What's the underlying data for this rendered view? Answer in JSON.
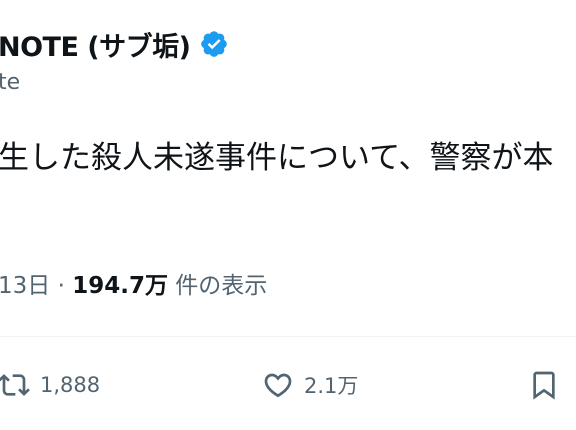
{
  "tweet": {
    "author_name": "NOTE (サブ垢)",
    "handle": "te",
    "text": "生した殺人未遂事件について、警察が本",
    "date": "13日",
    "separator": "·",
    "views_count": "194.7万",
    "views_label": "件の表示"
  },
  "actions": {
    "retweet_count": "1,888",
    "like_count": "2.1万"
  },
  "colors": {
    "verified_badge": "#1d9bf0",
    "secondary_text": "#536471",
    "primary_text": "#0f1419"
  },
  "icons": [
    "verified-badge-icon",
    "retweet-icon",
    "heart-icon",
    "bookmark-icon"
  ]
}
